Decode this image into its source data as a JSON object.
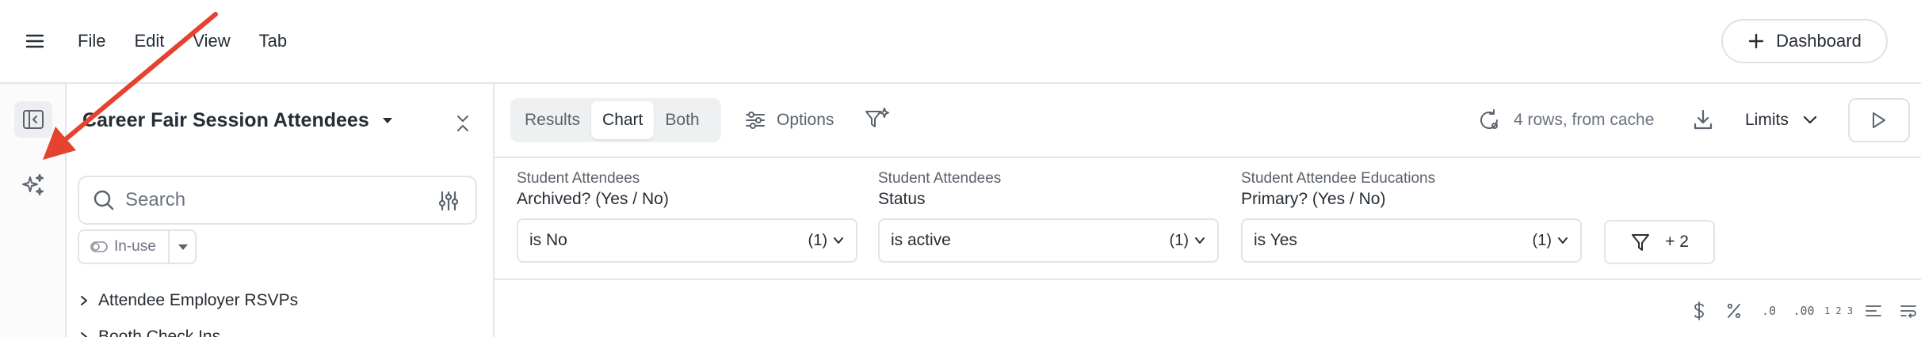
{
  "menubar": {
    "items": [
      "File",
      "Edit",
      "View",
      "Tab"
    ],
    "dashboard_label": "Dashboard"
  },
  "sidebar": {
    "explore_title": "Career Fair Session Attendees",
    "search_placeholder": "Search",
    "inuse_label": "In-use",
    "tree": [
      "Attendee Employer RSVPs",
      "Booth Check Ins"
    ]
  },
  "toolbar": {
    "tabs": [
      "Results",
      "Chart",
      "Both"
    ],
    "active_tab": "Chart",
    "options_label": "Options",
    "rows_label": "4 rows, from cache",
    "limits_label": "Limits"
  },
  "filters": [
    {
      "view": "Student Attendees",
      "field": "Archived? (Yes / No)",
      "value": "is No",
      "count": "(1)"
    },
    {
      "view": "Student Attendees",
      "field": "Status",
      "value": "is active",
      "count": "(1)"
    },
    {
      "view": "Student Attendee Educations",
      "field": "Primary? (Yes / No)",
      "value": "is Yes",
      "count": "(1)"
    }
  ],
  "more_filters_label": "+ 2",
  "format_toolbar": {
    "decimals_decrease": ".0",
    "decimals_increase": ".00",
    "number_format": "1 2 3"
  },
  "colors": {
    "annotation_arrow": "#e5432f",
    "border": "#e4e6ea",
    "text": "#262d34",
    "muted": "#6b7280"
  }
}
